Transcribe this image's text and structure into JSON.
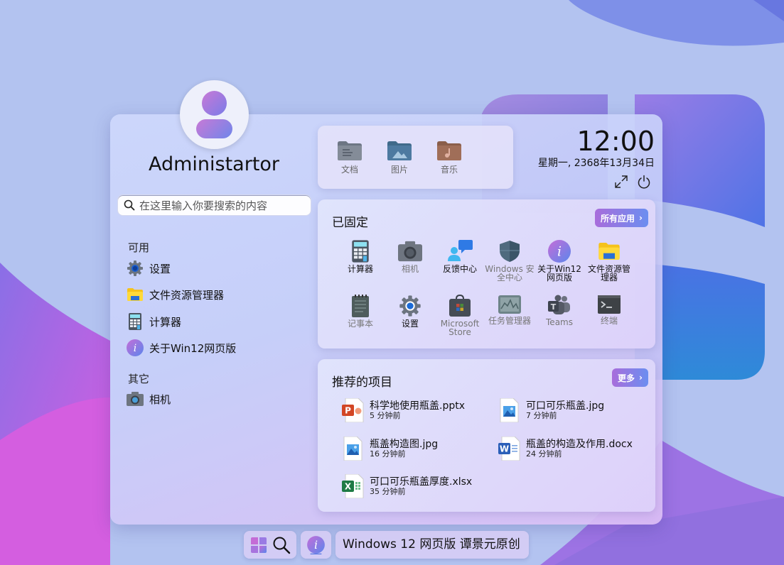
{
  "user": {
    "name": "Administartor"
  },
  "search": {
    "placeholder": "在这里输入你要搜索的内容"
  },
  "left": {
    "available_title": "可用",
    "available": [
      {
        "label": "设置",
        "icon": "settings-icon"
      },
      {
        "label": "文件资源管理器",
        "icon": "file-explorer-icon"
      },
      {
        "label": "计算器",
        "icon": "calculator-icon"
      },
      {
        "label": "关于Win12网页版",
        "icon": "about-icon"
      }
    ],
    "other_title": "其它",
    "other": [
      {
        "label": "相机",
        "icon": "camera-icon"
      }
    ]
  },
  "folders": [
    {
      "label": "文档",
      "icon": "documents-folder-icon"
    },
    {
      "label": "图片",
      "icon": "pictures-folder-icon"
    },
    {
      "label": "音乐",
      "icon": "music-folder-icon"
    }
  ],
  "clock": {
    "time": "12:00",
    "date": "星期一, 2368年13月34日"
  },
  "pinned": {
    "title": "已固定",
    "all_apps_label": "所有应用",
    "apps": [
      {
        "label": "计算器",
        "icon": "calculator-icon"
      },
      {
        "label": "相机",
        "icon": "camera-icon"
      },
      {
        "label": "反馈中心",
        "icon": "feedback-hub-icon"
      },
      {
        "label": "Windows 安全中心",
        "icon": "windows-security-icon"
      },
      {
        "label": "关于Win12网页版",
        "icon": "about-icon"
      },
      {
        "label": "文件资源管理器",
        "icon": "file-explorer-icon"
      },
      {
        "label": "记事本",
        "icon": "notepad-icon"
      },
      {
        "label": "设置",
        "icon": "settings-icon"
      },
      {
        "label": "Microsoft Store",
        "icon": "store-icon"
      },
      {
        "label": "任务管理器",
        "icon": "task-manager-icon"
      },
      {
        "label": "Teams",
        "icon": "teams-icon"
      },
      {
        "label": "终端",
        "icon": "terminal-icon"
      }
    ]
  },
  "recommended": {
    "title": "推荐的项目",
    "more_label": "更多",
    "items": [
      {
        "name": "科学地使用瓶盖.pptx",
        "time": "5 分钟前",
        "icon": "powerpoint-file-icon"
      },
      {
        "name": "可口可乐瓶盖.jpg",
        "time": "7 分钟前",
        "icon": "image-file-icon"
      },
      {
        "name": "瓶盖构造图.jpg",
        "time": "16 分钟前",
        "icon": "image-file-icon"
      },
      {
        "name": "瓶盖的构造及作用.docx",
        "time": "24 分钟前",
        "icon": "word-file-icon"
      },
      {
        "name": "可口可乐瓶盖厚度.xlsx",
        "time": "35 分钟前",
        "icon": "excel-file-icon"
      }
    ]
  },
  "taskbar": {
    "title": "Windows 12 网页版 谭景元原创"
  }
}
